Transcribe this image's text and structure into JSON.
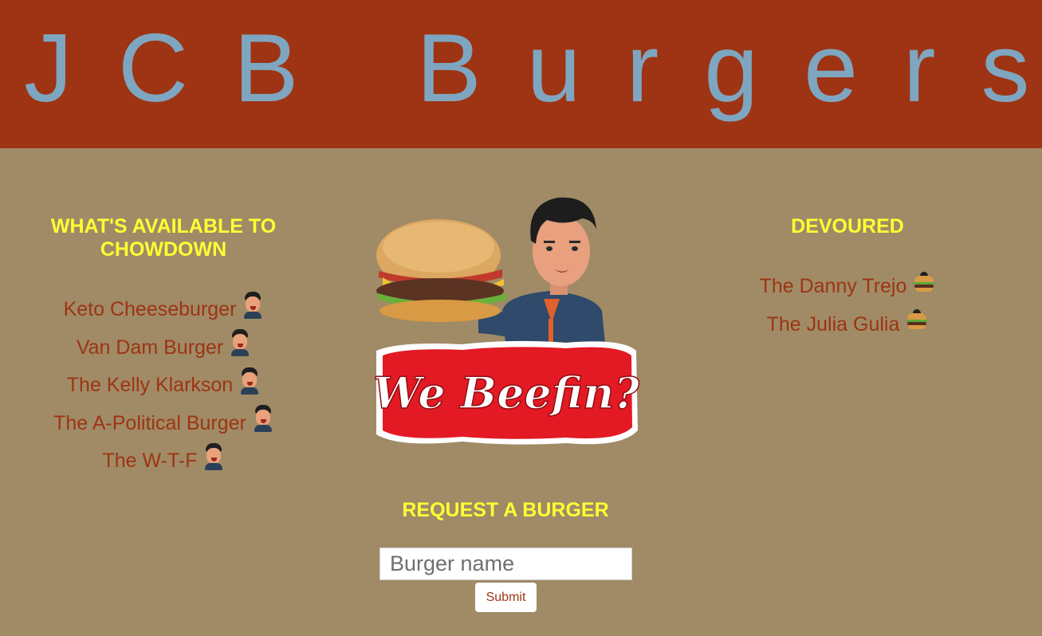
{
  "header": {
    "title": "JCB Burgers",
    "background_color": "#9e3413",
    "title_color": "#7ea6c0"
  },
  "available": {
    "heading": "WHAT'S AVAILABLE TO CHOWDOWN",
    "items": [
      {
        "label": "Keto Cheeseburger",
        "icon": "devour-face-icon"
      },
      {
        "label": "Van Dam Burger",
        "icon": "devour-face-icon"
      },
      {
        "label": "The Kelly Klarkson",
        "icon": "devour-face-icon"
      },
      {
        "label": "The A-Political Burger",
        "icon": "devour-face-icon"
      },
      {
        "label": "The W-T-F",
        "icon": "devour-face-icon"
      }
    ]
  },
  "devoured": {
    "heading": "DEVOURED",
    "items": [
      {
        "label": "The Danny Trejo",
        "icon": "burger-icon"
      },
      {
        "label": "The Julia Gulia",
        "icon": "burger-icon"
      }
    ]
  },
  "mascot": {
    "banner_text": "We Beefin?"
  },
  "request": {
    "heading": "REQUEST A BURGER",
    "input_placeholder": "Burger name",
    "input_value": "",
    "submit_label": "Submit"
  },
  "colors": {
    "page_background": "#a08b66",
    "heading": "#ffff33",
    "item_text": "#9e3413"
  }
}
